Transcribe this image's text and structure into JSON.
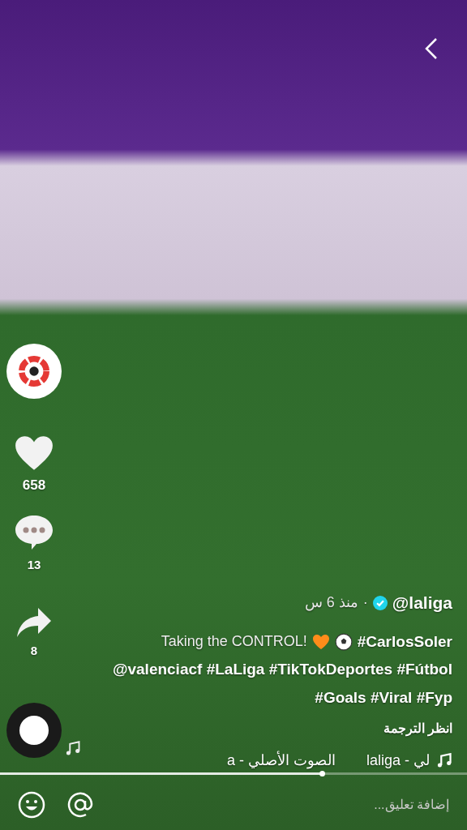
{
  "rail": {
    "likes": "658",
    "comments": "13",
    "shares": "8"
  },
  "post": {
    "handle": "@laliga",
    "verified": true,
    "time": "منذ 6 س",
    "separator": "·",
    "intro": "Taking the CONTROL!",
    "lines": [
      "#CarlosSoler",
      "@valenciacf #LaLiga #TikTokDeportes #Fútbol",
      "#Goals #Viral #Fyp"
    ],
    "translate": "انظر الترجمة",
    "sound": [
      "لي - laliga",
      "الصوت الأصلي - a"
    ]
  },
  "progress": {
    "level": 0.69
  },
  "comment_field": {
    "placeholder": "إضافة تعليق..."
  }
}
